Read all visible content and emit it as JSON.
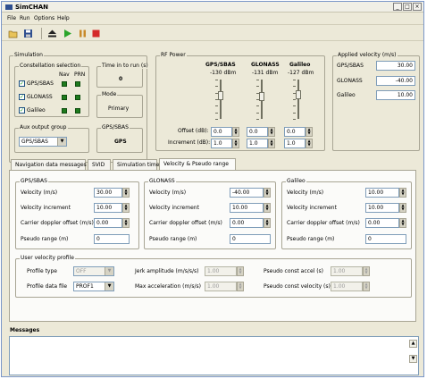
{
  "window": {
    "title": "SimCHAN",
    "buttons": [
      "_",
      "□",
      "×"
    ]
  },
  "menu": [
    "File",
    "Run",
    "Options",
    "Help"
  ],
  "toolbar": {
    "icons": [
      "open-icon",
      "save-icon",
      "eject-icon",
      "play-icon",
      "stop-icon"
    ]
  },
  "simulation": {
    "label": "Simulation",
    "constellation": {
      "label": "Constellation selection",
      "col_nav": "Nav",
      "col_prn": "PRN",
      "rows": [
        {
          "name": "GPS/SBAS",
          "checked": true
        },
        {
          "name": "GLONASS",
          "checked": true
        },
        {
          "name": "Galileo",
          "checked": true
        }
      ]
    },
    "time_to_run": {
      "label": "Time in to run (s)",
      "value": "0"
    },
    "mode": {
      "label": "Mode",
      "value": "Primary"
    },
    "aux_output": {
      "label": "Aux output group",
      "value": "GPS/SBAS"
    },
    "gps_sbas_box": {
      "label": "GPS/SBAS",
      "value": "GPS"
    }
  },
  "rf_power": {
    "label": "RF Power",
    "columns": [
      {
        "name": "GPS/SBAS",
        "dbm": "-130 dBm",
        "offset": "0.0",
        "increment": "1.0",
        "level": 0.62
      },
      {
        "name": "GLONASS",
        "dbm": "-131 dBm",
        "offset": "0.0",
        "increment": "1.0",
        "level": 0.6
      },
      {
        "name": "Galileo",
        "dbm": "-127 dBm",
        "offset": "0.0",
        "increment": "1.0",
        "level": 0.66
      }
    ],
    "offset_label": "Offset (dB):",
    "increment_label": "Increment (dB):"
  },
  "applied_velocity": {
    "label": "Applied velocity (m/s)",
    "rows": [
      {
        "name": "GPS/SBAS",
        "value": "30.00"
      },
      {
        "name": "GLONASS",
        "value": "-40.00"
      },
      {
        "name": "Galileo",
        "value": "10.00"
      }
    ]
  },
  "tabs": [
    "Navigation data messages",
    "SVID",
    "Simulation time",
    "Velocity & Pseudo range"
  ],
  "velocity_panel": {
    "groups": [
      {
        "label": "GPS/SBAS",
        "velocity": "30.00",
        "velocity_increment": "10.00",
        "carrier_offset": "0.00",
        "pseudo_range": "0"
      },
      {
        "label": "GLONASS",
        "velocity": "-40.00",
        "velocity_increment": "10.00",
        "carrier_offset": "0.00",
        "pseudo_range": "0"
      },
      {
        "label": "Galileo",
        "velocity": "10.00",
        "velocity_increment": "10.00",
        "carrier_offset": "0.00",
        "pseudo_range": "0"
      }
    ],
    "field_labels": {
      "velocity": "Velocity (m/s)",
      "velocity_increment": "Velocity increment",
      "carrier_offset": "Carrier doppler offset (m/s)",
      "pseudo_range": "Pseudo range (m)"
    },
    "user_profile": {
      "label": "User velocity profile",
      "profile_type_label": "Profile type",
      "profile_type_value": "OFF",
      "profile_file_label": "Profile data file",
      "profile_file_value": "PROF1",
      "jerk_label": "Jerk amplitude (m/s/s/s)",
      "jerk_value": "1.00",
      "max_accel_label": "Max acceleration (m/s/s)",
      "max_accel_value": "1.00",
      "pr_accel_label": "Pseudo const accel (s)",
      "pr_accel_value": "1.00",
      "pr_vel_label": "Pseudo const velocity (s)",
      "pr_vel_value": "1.00"
    }
  },
  "messages": {
    "label": "Messages"
  }
}
